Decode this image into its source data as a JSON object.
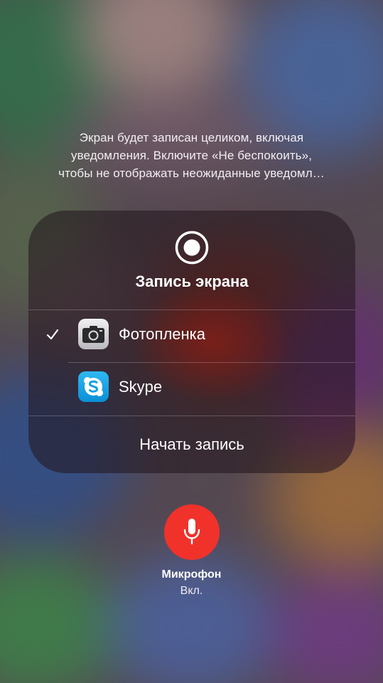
{
  "info": {
    "line1": "Экран будет записан целиком, включая",
    "line2": "уведомления. Включите «Не беспокоить»,",
    "line3": "чтобы не отображать неожиданные уведомл…"
  },
  "panel": {
    "title": "Запись экрана",
    "record_icon": "screen-record-icon",
    "destinations": [
      {
        "label": "Фотопленка",
        "icon": "camera-app-icon",
        "selected": true
      },
      {
        "label": "Skype",
        "icon": "skype-app-icon",
        "selected": false
      }
    ],
    "start_label": "Начать запись"
  },
  "microphone": {
    "label": "Микрофон",
    "state": "Вкл.",
    "icon": "microphone-icon",
    "button_color": "#f0322b"
  }
}
